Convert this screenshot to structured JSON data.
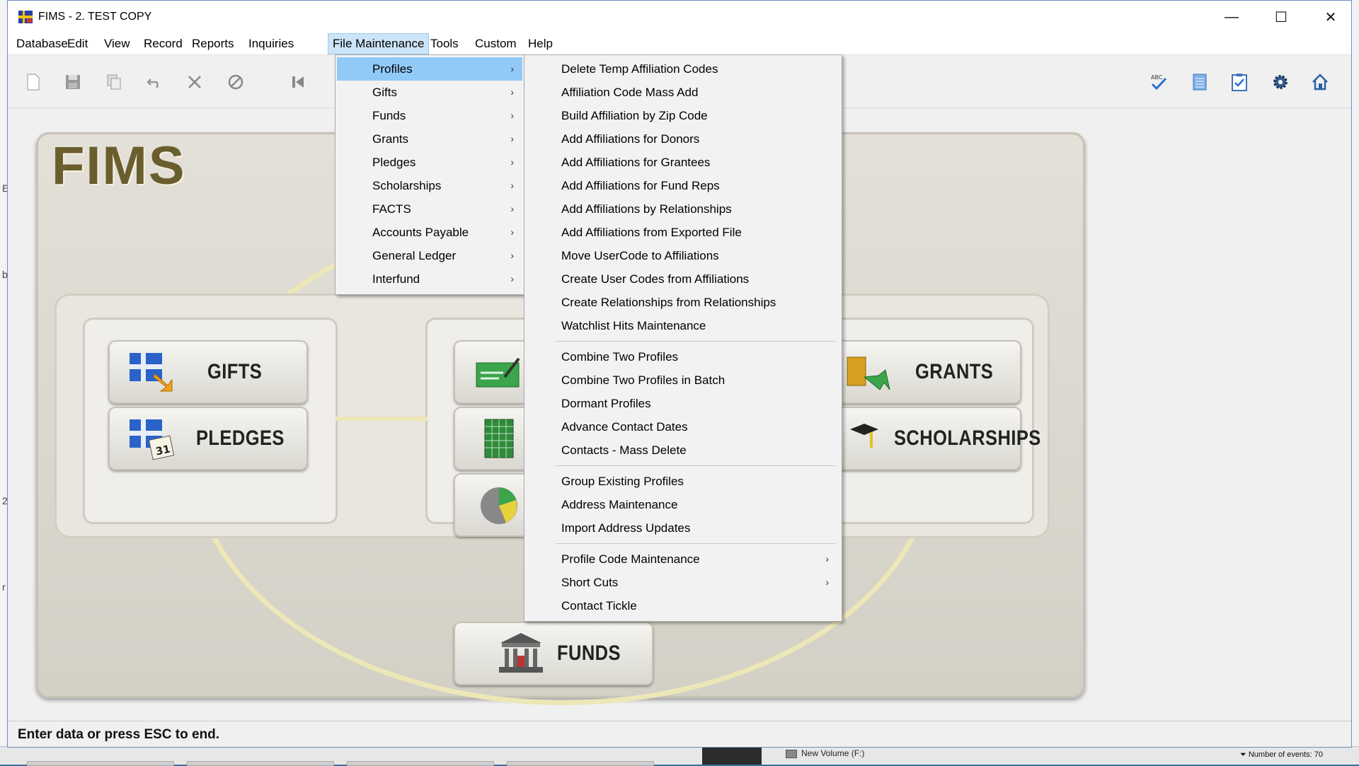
{
  "window": {
    "title": "FIMS - 2. TEST COPY",
    "controls": {
      "minimize": "—",
      "maximize": "☐",
      "close": "✕"
    }
  },
  "menubar": {
    "items": [
      "Database",
      "Edit",
      "View",
      "Record",
      "Reports",
      "Inquiries",
      "File Maintenance",
      "Tools",
      "Custom",
      "Help"
    ],
    "active": "File Maintenance"
  },
  "toolbar": {
    "left_icons": [
      "new-document-icon",
      "save-icon",
      "copy-icon",
      "undo-icon",
      "delete-icon",
      "cancel-icon",
      "first-record-icon"
    ],
    "right_icons": [
      "spell-check-icon",
      "notepad-icon",
      "checklist-icon",
      "settings-gear-icon",
      "home-icon"
    ]
  },
  "dashboard": {
    "logo": "FIMS",
    "modules": {
      "gifts": "GIFTS",
      "pledges": "PLEDGES",
      "grants": "GRANTS",
      "scholarships": "SCHOLARSHIPS",
      "funds": "FUNDS"
    }
  },
  "file_maintenance_menu": {
    "items": [
      "Profiles",
      "Gifts",
      "Funds",
      "Grants",
      "Pledges",
      "Scholarships",
      "FACTS",
      "Accounts Payable",
      "General Ledger",
      "Interfund"
    ],
    "highlighted": "Profiles"
  },
  "profiles_submenu": {
    "group1": [
      "Delete Temp Affiliation Codes",
      "Affiliation Code Mass Add",
      "Build Affiliation by Zip Code",
      "Add Affiliations for Donors",
      "Add Affiliations for Grantees",
      "Add Affiliations for Fund Reps",
      "Add Affiliations by Relationships",
      "Add Affiliations from Exported File",
      "Move UserCode to Affiliations",
      "Create User Codes from Affiliations",
      "Create Relationships from Relationships",
      "Watchlist Hits Maintenance"
    ],
    "group2": [
      "Combine Two Profiles",
      "Combine Two Profiles in Batch",
      "Dormant Profiles",
      "Advance Contact Dates",
      "Contacts - Mass Delete"
    ],
    "group3": [
      "Group Existing Profiles",
      "Address Maintenance",
      "Import Address Updates"
    ],
    "group4": [
      {
        "label": "Profile Code Maintenance",
        "submenu": true
      },
      {
        "label": "Short Cuts",
        "submenu": true
      },
      {
        "label": "Contact Tickle",
        "submenu": false
      }
    ],
    "submenu_arrow": "›"
  },
  "statusbar": {
    "text": "Enter data or press ESC to end."
  },
  "background": {
    "taskbar_volume": "New Volume (F:)",
    "events_text": "Number of events: 70"
  }
}
